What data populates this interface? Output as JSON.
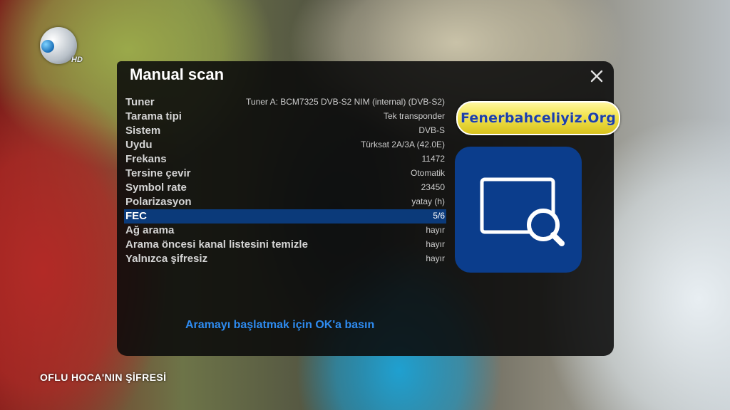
{
  "channel": {
    "hd_label": "HD"
  },
  "dialog": {
    "title": "Manual scan",
    "rows": [
      {
        "label": "Tuner",
        "value": "Tuner A: BCM7325 DVB-S2 NIM (internal) (DVB-S2)"
      },
      {
        "label": "Tarama tipi",
        "value": "Tek transponder"
      },
      {
        "label": "Sistem",
        "value": "DVB-S"
      },
      {
        "label": "Uydu",
        "value": "Türksat 2A/3A (42.0E)"
      },
      {
        "label": "Frekans",
        "value": "11472"
      },
      {
        "label": "Tersine çevir",
        "value": "Otomatik"
      },
      {
        "label": "Symbol rate",
        "value": "23450"
      },
      {
        "label": "Polarizasyon",
        "value": "yatay (h)"
      },
      {
        "label": "FEC",
        "value": "5/6"
      },
      {
        "label": "Ağ arama",
        "value": "hayır"
      },
      {
        "label": "Arama öncesi kanal listesini temizle",
        "value": "hayır"
      },
      {
        "label": "Yalnızca şifresiz",
        "value": "hayır"
      }
    ],
    "selected_row": "FEC",
    "hint": "Aramayı başlatmak için OK'a basın",
    "watermark": "Fenerbahceliyiz.Org",
    "icon": "screen-search-icon",
    "colors": {
      "selection": "#0b3a7a",
      "hint": "#2e8bf0",
      "icon_bg": "#0b3d8c"
    }
  },
  "caption": "OFLU HOCA'NIN ŞİFRESİ"
}
